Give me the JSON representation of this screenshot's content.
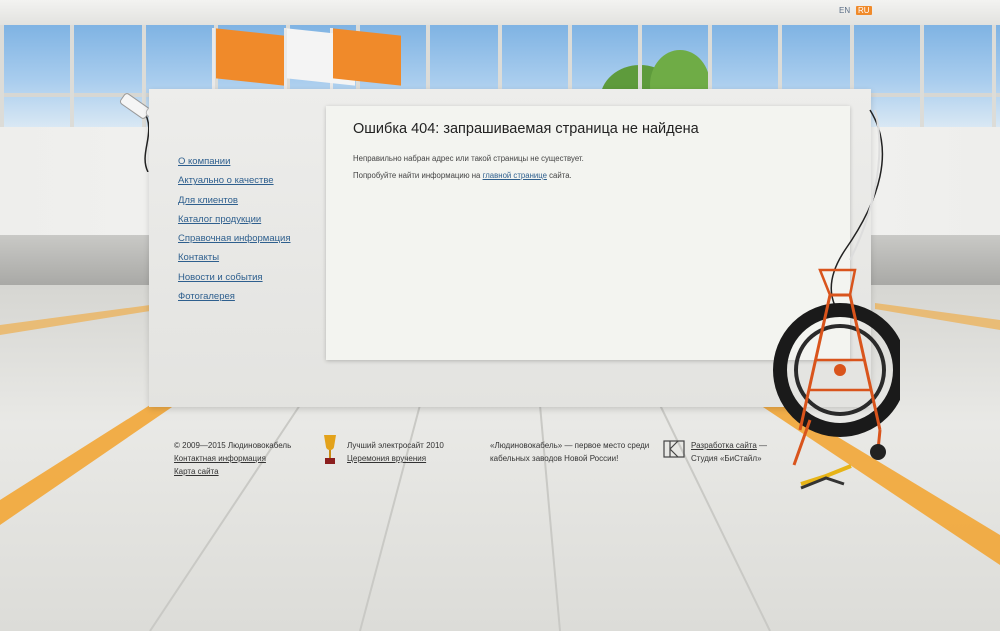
{
  "lang": {
    "en": "EN",
    "ru": "RU"
  },
  "nav": {
    "items": [
      "О компании",
      "Актуально о качестве",
      "Для клиентов",
      "Каталог продукции",
      "Справочная информация",
      "Контакты",
      "Новости и события",
      "Фотогалерея"
    ]
  },
  "main": {
    "title": "Ошибка 404: запрашиваемая страница не найдена",
    "line1": "Неправильно набран адрес или такой страницы не существует.",
    "line2_prefix": "Попробуйте найти информацию на ",
    "line2_link": "главной странице",
    "line2_suffix": " сайта."
  },
  "footer": {
    "copyright": "© 2009—2015 Людиновокабель",
    "contact_link": "Контактная информация",
    "sitemap_link": "Карта сайта",
    "award_text": "Лучший электросайт 2010",
    "award_link": "Церемония вручения",
    "slogan_line1": "«Людиновокабель» — первое место среди",
    "slogan_line2": "кабельных заводов Новой России!",
    "dev_link": "Разработка сайта",
    "dev_dash": " —",
    "studio": "Студия «БиСтайл»"
  },
  "colors": {
    "accent": "#f08a2a",
    "link": "#2e5f8e"
  }
}
